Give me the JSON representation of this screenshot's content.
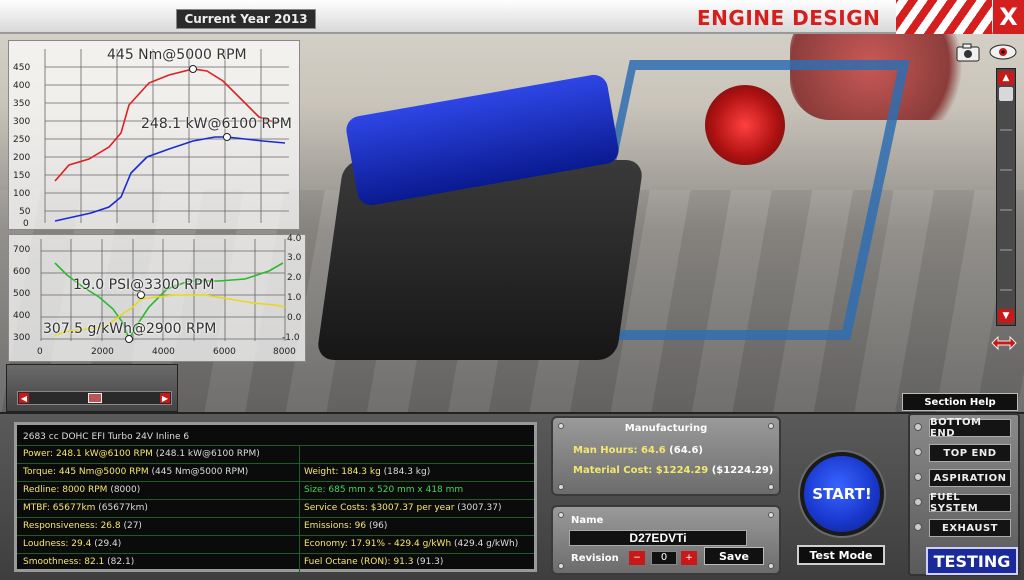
{
  "header": {
    "year_label": "Current Year 2013",
    "title": "ENGINE DESIGN",
    "close_label": "X"
  },
  "graph_top": {
    "torque_peak_label": "445 Nm@5000 RPM",
    "power_peak_label": "248.1 kW@6100 RPM",
    "y_ticks": [
      "450",
      "400",
      "350",
      "300",
      "250",
      "200",
      "150",
      "100",
      "50",
      "0"
    ],
    "colors": {
      "torque": "#e02020",
      "power": "#1a2ad8"
    }
  },
  "graph_bottom": {
    "boost_label": "19.0 PSI@3300 RPM",
    "bsfc_label": "307.5 g/kWh@2900 RPM",
    "y_left_ticks": [
      "700",
      "600",
      "500",
      "400",
      "300"
    ],
    "y_right_ticks": [
      "4.0",
      "3.0",
      "2.0",
      "1.0",
      "0.0",
      "-1.0"
    ],
    "x_ticks": [
      "0",
      "2000",
      "4000",
      "6000",
      "8000"
    ],
    "colors": {
      "boost": "#2db82d",
      "bsfc": "#e8d81a"
    }
  },
  "stats": {
    "engine_desc": "2683 cc DOHC EFI Turbo 24V Inline 6",
    "left": [
      {
        "text": "Power: 248.1 kW@6100 RPM",
        "extra": " (248.1 kW@6100 RPM)",
        "tone": "hl"
      },
      {
        "text": "Torque: 445 Nm@5000 RPM",
        "extra": " (445 Nm@5000 RPM)",
        "tone": "hl"
      },
      {
        "text": "Redline: 8000 RPM",
        "extra": " (8000)",
        "tone": "hl"
      },
      {
        "text": "MTBF: 65677km",
        "extra": " (65677km)",
        "tone": "hl"
      },
      {
        "text": "Responsiveness: 26.8",
        "extra": " (27)",
        "tone": "hl"
      },
      {
        "text": "Loudness: 29.4",
        "extra": " (29.4)",
        "tone": "hl"
      },
      {
        "text": "Smoothness: 82.1",
        "extra": " (82.1)",
        "tone": "hl"
      }
    ],
    "right": [
      {
        "text": "Weight: 184.3 kg",
        "extra": " (184.3 kg)",
        "tone": "hl"
      },
      {
        "text": "Size: 685 mm x 520 mm x 418 mm",
        "extra": "",
        "tone": "gr"
      },
      {
        "text": "Service Costs: $3007.37 per year",
        "extra": " (3007.37)",
        "tone": "hl"
      },
      {
        "text": "Emissions: 96",
        "extra": " (96)",
        "tone": "hl"
      },
      {
        "text": "Economy: 17.91% - 429.4 g/kWh",
        "extra": " (429.4 g/kWh)",
        "tone": "hl"
      },
      {
        "text": "Fuel Octane (RON): 91.3",
        "extra": " (91.3)",
        "tone": "hl"
      }
    ]
  },
  "manufacturing": {
    "title": "Manufacturing",
    "man_hours_label": "Man Hours: 64.6",
    "man_hours_prev": " (64.6)",
    "material_label": "Material Cost: $1224.29",
    "material_prev": " ($1224.29)"
  },
  "name_panel": {
    "name_label": "Name",
    "name_value": "D27EDVTi",
    "revision_label": "Revision",
    "revision_value": "0",
    "save_label": "Save"
  },
  "actions": {
    "start_label": "START!",
    "test_mode_label": "Test Mode"
  },
  "side_nav": {
    "help_label": "Section Help",
    "items": [
      "BOTTOM END",
      "TOP END",
      "ASPIRATION",
      "FUEL SYSTEM",
      "EXHAUST"
    ],
    "active_label": "TESTING"
  }
}
